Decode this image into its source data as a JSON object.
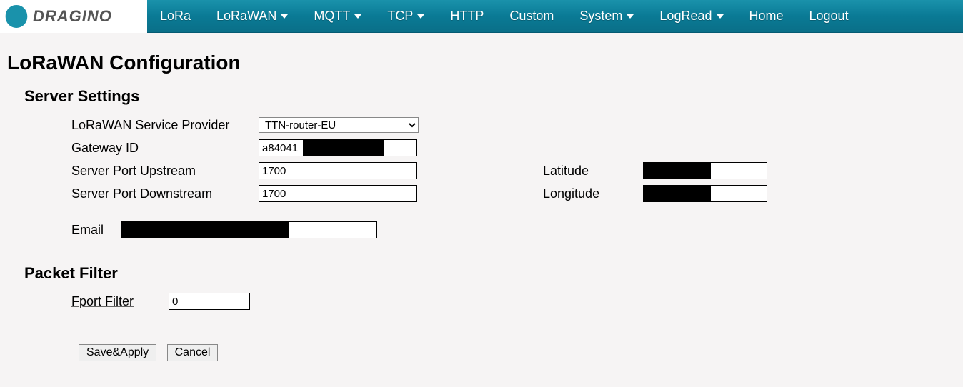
{
  "brand": {
    "name": "DRAGINO"
  },
  "nav": {
    "lora": "LoRa",
    "lorawan": "LoRaWAN",
    "mqtt": "MQTT",
    "tcp": "TCP",
    "http": "HTTP",
    "custom": "Custom",
    "system": "System",
    "logread": "LogRead",
    "home": "Home",
    "logout": "Logout"
  },
  "page": {
    "title": "LoRaWAN Configuration",
    "sections": {
      "server": "Server Settings",
      "filter": "Packet Filter"
    }
  },
  "server": {
    "provider_label": "LoRaWAN Service Provider",
    "provider_value": "TTN-router-EU",
    "gatewayid_label": "Gateway ID",
    "gatewayid_value": "a84041",
    "upstream_label": "Server Port Upstream",
    "upstream_value": "1700",
    "downstream_label": "Server Port Downstream",
    "downstream_value": "1700",
    "latitude_label": "Latitude",
    "latitude_value": "",
    "longitude_label": "Longitude",
    "longitude_value": "",
    "email_label": "Email",
    "email_value": ""
  },
  "filter": {
    "fport_label": "Fport Filter",
    "fport_value": "0"
  },
  "buttons": {
    "save": "Save&Apply",
    "cancel": "Cancel"
  }
}
